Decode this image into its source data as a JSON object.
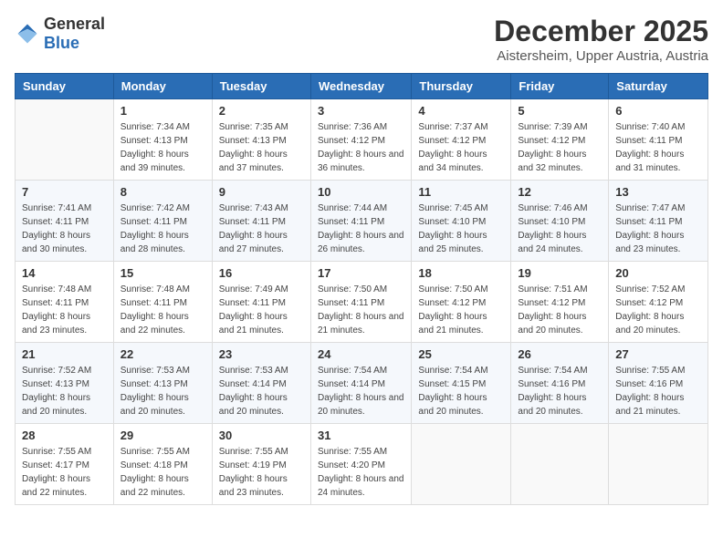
{
  "header": {
    "logo_general": "General",
    "logo_blue": "Blue",
    "month_title": "December 2025",
    "location": "Aistersheim, Upper Austria, Austria"
  },
  "days_of_week": [
    "Sunday",
    "Monday",
    "Tuesday",
    "Wednesday",
    "Thursday",
    "Friday",
    "Saturday"
  ],
  "weeks": [
    [
      {
        "day": "",
        "sunrise": "",
        "sunset": "",
        "daylight": ""
      },
      {
        "day": "1",
        "sunrise": "Sunrise: 7:34 AM",
        "sunset": "Sunset: 4:13 PM",
        "daylight": "Daylight: 8 hours and 39 minutes."
      },
      {
        "day": "2",
        "sunrise": "Sunrise: 7:35 AM",
        "sunset": "Sunset: 4:13 PM",
        "daylight": "Daylight: 8 hours and 37 minutes."
      },
      {
        "day": "3",
        "sunrise": "Sunrise: 7:36 AM",
        "sunset": "Sunset: 4:12 PM",
        "daylight": "Daylight: 8 hours and 36 minutes."
      },
      {
        "day": "4",
        "sunrise": "Sunrise: 7:37 AM",
        "sunset": "Sunset: 4:12 PM",
        "daylight": "Daylight: 8 hours and 34 minutes."
      },
      {
        "day": "5",
        "sunrise": "Sunrise: 7:39 AM",
        "sunset": "Sunset: 4:12 PM",
        "daylight": "Daylight: 8 hours and 32 minutes."
      },
      {
        "day": "6",
        "sunrise": "Sunrise: 7:40 AM",
        "sunset": "Sunset: 4:11 PM",
        "daylight": "Daylight: 8 hours and 31 minutes."
      }
    ],
    [
      {
        "day": "7",
        "sunrise": "Sunrise: 7:41 AM",
        "sunset": "Sunset: 4:11 PM",
        "daylight": "Daylight: 8 hours and 30 minutes."
      },
      {
        "day": "8",
        "sunrise": "Sunrise: 7:42 AM",
        "sunset": "Sunset: 4:11 PM",
        "daylight": "Daylight: 8 hours and 28 minutes."
      },
      {
        "day": "9",
        "sunrise": "Sunrise: 7:43 AM",
        "sunset": "Sunset: 4:11 PM",
        "daylight": "Daylight: 8 hours and 27 minutes."
      },
      {
        "day": "10",
        "sunrise": "Sunrise: 7:44 AM",
        "sunset": "Sunset: 4:11 PM",
        "daylight": "Daylight: 8 hours and 26 minutes."
      },
      {
        "day": "11",
        "sunrise": "Sunrise: 7:45 AM",
        "sunset": "Sunset: 4:10 PM",
        "daylight": "Daylight: 8 hours and 25 minutes."
      },
      {
        "day": "12",
        "sunrise": "Sunrise: 7:46 AM",
        "sunset": "Sunset: 4:10 PM",
        "daylight": "Daylight: 8 hours and 24 minutes."
      },
      {
        "day": "13",
        "sunrise": "Sunrise: 7:47 AM",
        "sunset": "Sunset: 4:11 PM",
        "daylight": "Daylight: 8 hours and 23 minutes."
      }
    ],
    [
      {
        "day": "14",
        "sunrise": "Sunrise: 7:48 AM",
        "sunset": "Sunset: 4:11 PM",
        "daylight": "Daylight: 8 hours and 23 minutes."
      },
      {
        "day": "15",
        "sunrise": "Sunrise: 7:48 AM",
        "sunset": "Sunset: 4:11 PM",
        "daylight": "Daylight: 8 hours and 22 minutes."
      },
      {
        "day": "16",
        "sunrise": "Sunrise: 7:49 AM",
        "sunset": "Sunset: 4:11 PM",
        "daylight": "Daylight: 8 hours and 21 minutes."
      },
      {
        "day": "17",
        "sunrise": "Sunrise: 7:50 AM",
        "sunset": "Sunset: 4:11 PM",
        "daylight": "Daylight: 8 hours and 21 minutes."
      },
      {
        "day": "18",
        "sunrise": "Sunrise: 7:50 AM",
        "sunset": "Sunset: 4:12 PM",
        "daylight": "Daylight: 8 hours and 21 minutes."
      },
      {
        "day": "19",
        "sunrise": "Sunrise: 7:51 AM",
        "sunset": "Sunset: 4:12 PM",
        "daylight": "Daylight: 8 hours and 20 minutes."
      },
      {
        "day": "20",
        "sunrise": "Sunrise: 7:52 AM",
        "sunset": "Sunset: 4:12 PM",
        "daylight": "Daylight: 8 hours and 20 minutes."
      }
    ],
    [
      {
        "day": "21",
        "sunrise": "Sunrise: 7:52 AM",
        "sunset": "Sunset: 4:13 PM",
        "daylight": "Daylight: 8 hours and 20 minutes."
      },
      {
        "day": "22",
        "sunrise": "Sunrise: 7:53 AM",
        "sunset": "Sunset: 4:13 PM",
        "daylight": "Daylight: 8 hours and 20 minutes."
      },
      {
        "day": "23",
        "sunrise": "Sunrise: 7:53 AM",
        "sunset": "Sunset: 4:14 PM",
        "daylight": "Daylight: 8 hours and 20 minutes."
      },
      {
        "day": "24",
        "sunrise": "Sunrise: 7:54 AM",
        "sunset": "Sunset: 4:14 PM",
        "daylight": "Daylight: 8 hours and 20 minutes."
      },
      {
        "day": "25",
        "sunrise": "Sunrise: 7:54 AM",
        "sunset": "Sunset: 4:15 PM",
        "daylight": "Daylight: 8 hours and 20 minutes."
      },
      {
        "day": "26",
        "sunrise": "Sunrise: 7:54 AM",
        "sunset": "Sunset: 4:16 PM",
        "daylight": "Daylight: 8 hours and 20 minutes."
      },
      {
        "day": "27",
        "sunrise": "Sunrise: 7:55 AM",
        "sunset": "Sunset: 4:16 PM",
        "daylight": "Daylight: 8 hours and 21 minutes."
      }
    ],
    [
      {
        "day": "28",
        "sunrise": "Sunrise: 7:55 AM",
        "sunset": "Sunset: 4:17 PM",
        "daylight": "Daylight: 8 hours and 22 minutes."
      },
      {
        "day": "29",
        "sunrise": "Sunrise: 7:55 AM",
        "sunset": "Sunset: 4:18 PM",
        "daylight": "Daylight: 8 hours and 22 minutes."
      },
      {
        "day": "30",
        "sunrise": "Sunrise: 7:55 AM",
        "sunset": "Sunset: 4:19 PM",
        "daylight": "Daylight: 8 hours and 23 minutes."
      },
      {
        "day": "31",
        "sunrise": "Sunrise: 7:55 AM",
        "sunset": "Sunset: 4:20 PM",
        "daylight": "Daylight: 8 hours and 24 minutes."
      },
      {
        "day": "",
        "sunrise": "",
        "sunset": "",
        "daylight": ""
      },
      {
        "day": "",
        "sunrise": "",
        "sunset": "",
        "daylight": ""
      },
      {
        "day": "",
        "sunrise": "",
        "sunset": "",
        "daylight": ""
      }
    ]
  ]
}
